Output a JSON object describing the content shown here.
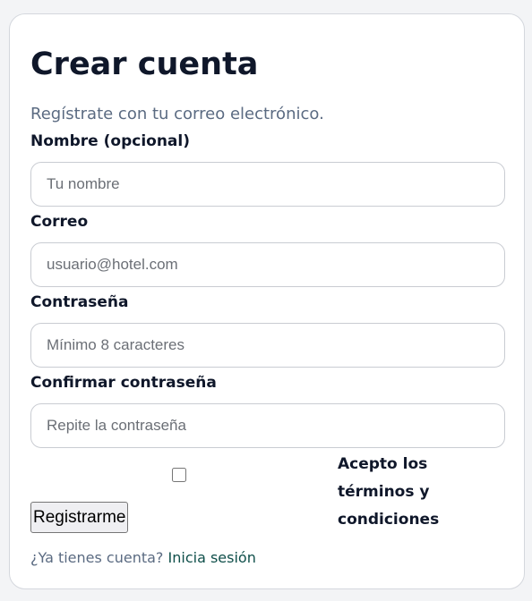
{
  "form": {
    "title": "Crear cuenta",
    "subtitle": "Regístrate con tu correo electrónico.",
    "fields": [
      {
        "label": "Nombre (opcional)",
        "placeholder": "Tu nombre",
        "value": ""
      },
      {
        "label": "Correo",
        "placeholder": "usuario@hotel.com",
        "value": ""
      },
      {
        "label": "Contraseña",
        "placeholder": "Mínimo 8 caracteres",
        "value": ""
      },
      {
        "label": "Confirmar contraseña",
        "placeholder": "Repite la contraseña",
        "value": ""
      }
    ],
    "terms_label": "Acepto los términos y condiciones",
    "terms_checked": false,
    "submit_label": "Registrarme",
    "footer_text": "¿Ya tienes cuenta?",
    "footer_link": "Inicia sesión"
  },
  "colors": {
    "page_background": "#f3f4f6",
    "card_background": "#ffffff",
    "text_primary": "#0f172a",
    "text_muted": "#5b6b82",
    "link": "#0f4f4a"
  }
}
